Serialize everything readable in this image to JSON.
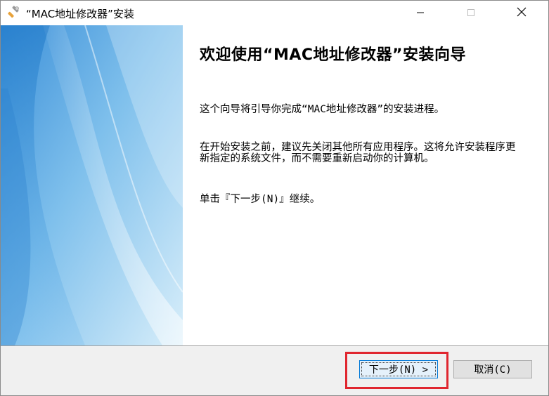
{
  "window": {
    "title": "“MAC地址修改器”安装",
    "icon": "installer-wrench-icon",
    "controls": [
      "minimize-icon",
      "maximize-icon",
      "close-icon"
    ]
  },
  "content": {
    "heading": "欢迎使用“MAC地址修改器”安装向导",
    "paragraph1": "这个向导将引导你完成“MAC地址修改器”的安装进程。",
    "paragraph2": "在开始安装之前，建议先关闭其他所有应用程序。这将允许安装程序更新指定的系统文件，而不需要重新启动你的计算机。",
    "paragraph3": "单击『下一步(N)』继续。"
  },
  "buttons": {
    "next_label": "下一步(N) >",
    "cancel_label": "取消(C)"
  },
  "colors": {
    "highlight": "#e0262f",
    "banner_blue": "#2f8fd6",
    "focus_border": "#0078d7"
  }
}
